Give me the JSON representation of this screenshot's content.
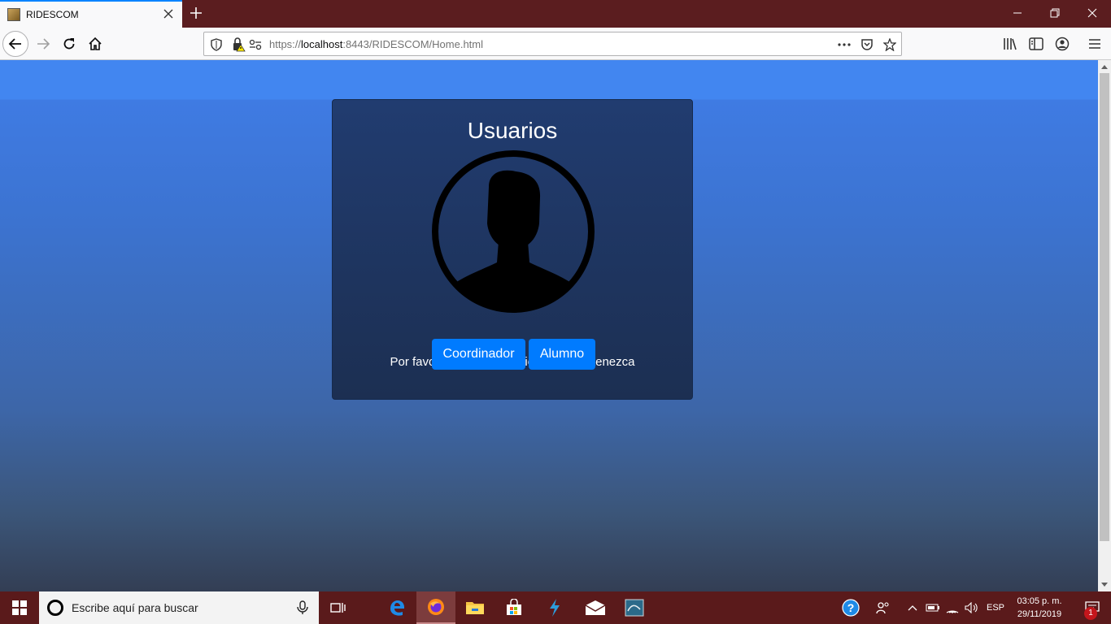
{
  "browser": {
    "tab_title": "RIDESCOM",
    "url_prefix": "https://",
    "url_host": "localhost",
    "url_rest": ":8443/RIDESCOM/Home.html"
  },
  "page": {
    "card_title": "Usuarios",
    "prompt": "Por favor escoja el usuario al que pertenezca",
    "buttons": {
      "coordinator": "Coordinador",
      "student": "Alumno"
    },
    "accent_color": "#007bff"
  },
  "taskbar": {
    "search_placeholder": "Escribe aquí para buscar",
    "language": "ESP",
    "time": "03:05 p. m.",
    "date": "29/11/2019",
    "notification_count": "1"
  }
}
